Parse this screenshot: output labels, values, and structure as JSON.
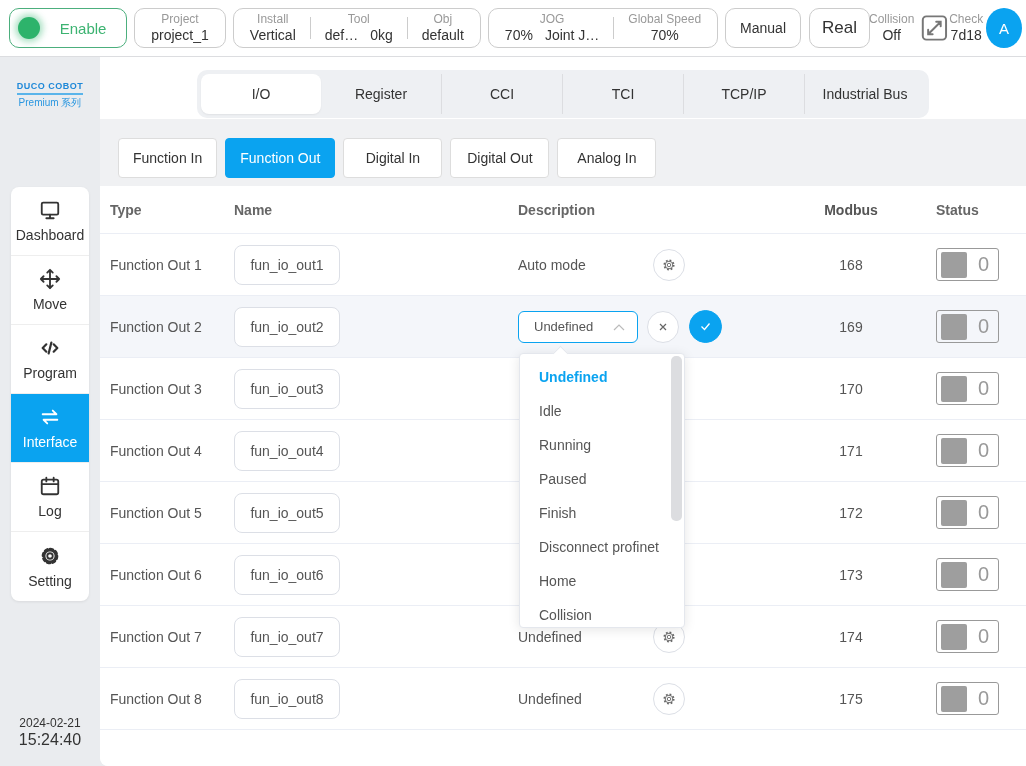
{
  "topbar": {
    "enable": {
      "label": "Enable",
      "on": true
    },
    "cards": [
      {
        "fields": [
          {
            "label": "Project",
            "values": [
              "project_1"
            ]
          }
        ]
      },
      {
        "fields": [
          {
            "label": "Install",
            "values": [
              "Vertical"
            ]
          },
          {
            "label": "Tool",
            "values": [
              "def…",
              "0kg"
            ]
          },
          {
            "label": "Obj",
            "values": [
              "default"
            ]
          }
        ]
      },
      {
        "fields": [
          {
            "label": "JOG",
            "values": [
              "70%",
              "Joint J…"
            ]
          },
          {
            "label": "Global Speed",
            "values": [
              "70%"
            ]
          }
        ]
      }
    ],
    "buttons": [
      "Manual",
      "Real"
    ],
    "collision": {
      "label": "Collision",
      "value": "Off"
    },
    "check": {
      "label": "Check",
      "value": "7d18"
    },
    "avatar": "A"
  },
  "sidebar": {
    "logo": "DUCO COBOT",
    "series": "Premium 系列",
    "items": [
      {
        "label": "Dashboard",
        "selected": false
      },
      {
        "label": "Move",
        "selected": false
      },
      {
        "label": "Program",
        "selected": false
      },
      {
        "label": "Interface",
        "selected": true
      },
      {
        "label": "Log",
        "selected": false
      },
      {
        "label": "Setting",
        "selected": false
      }
    ],
    "date": "2024-02-21",
    "time": "15:24:40"
  },
  "tabs": [
    {
      "label": "I/O",
      "selected": true
    },
    {
      "label": "Register",
      "selected": false
    },
    {
      "label": "CCI",
      "selected": false
    },
    {
      "label": "TCI",
      "selected": false
    },
    {
      "label": "TCP/IP",
      "selected": false
    },
    {
      "label": "Industrial Bus",
      "selected": false
    }
  ],
  "sub_tabs": [
    {
      "label": "Function In",
      "selected": false
    },
    {
      "label": "Function Out",
      "selected": true
    },
    {
      "label": "Digital In",
      "selected": false
    },
    {
      "label": "Digital Out",
      "selected": false
    },
    {
      "label": "Analog In",
      "selected": false
    }
  ],
  "table": {
    "columns": [
      "Type",
      "Name",
      "Description",
      "Modbus",
      "Status"
    ],
    "rows": [
      {
        "type": "Function Out 1",
        "name": "fun_io_out1",
        "description": "Auto mode",
        "editing": false,
        "modbus": "168",
        "status": "0",
        "on": false
      },
      {
        "type": "Function Out 2",
        "name": "fun_io_out2",
        "description": "Undefined",
        "editing": true,
        "modbus": "169",
        "status": "0",
        "on": false
      },
      {
        "type": "Function Out 3",
        "name": "fun_io_out3",
        "modbus": "170",
        "status": "0",
        "on": false
      },
      {
        "type": "Function Out 4",
        "name": "fun_io_out4",
        "modbus": "171",
        "status": "0",
        "on": false
      },
      {
        "type": "Function Out 5",
        "name": "fun_io_out5",
        "modbus": "172",
        "status": "0",
        "on": false
      },
      {
        "type": "Function Out 6",
        "name": "fun_io_out6",
        "modbus": "173",
        "status": "0",
        "on": false
      },
      {
        "type": "Function Out 7",
        "name": "fun_io_out7",
        "description": "Undefined",
        "editing": false,
        "modbus": "174",
        "status": "0",
        "on": false
      },
      {
        "type": "Function Out 8",
        "name": "fun_io_out8",
        "description": "Undefined",
        "editing": false,
        "modbus": "175",
        "status": "0",
        "on": false
      }
    ]
  },
  "dropdown": {
    "options": [
      {
        "label": "Undefined",
        "selected": true
      },
      {
        "label": "Idle",
        "selected": false
      },
      {
        "label": "Running",
        "selected": false
      },
      {
        "label": "Paused",
        "selected": false
      },
      {
        "label": "Finish",
        "selected": false
      },
      {
        "label": "Disconnect profinet",
        "selected": false
      },
      {
        "label": "Home",
        "selected": false
      },
      {
        "label": "Collision",
        "selected": false
      }
    ]
  }
}
